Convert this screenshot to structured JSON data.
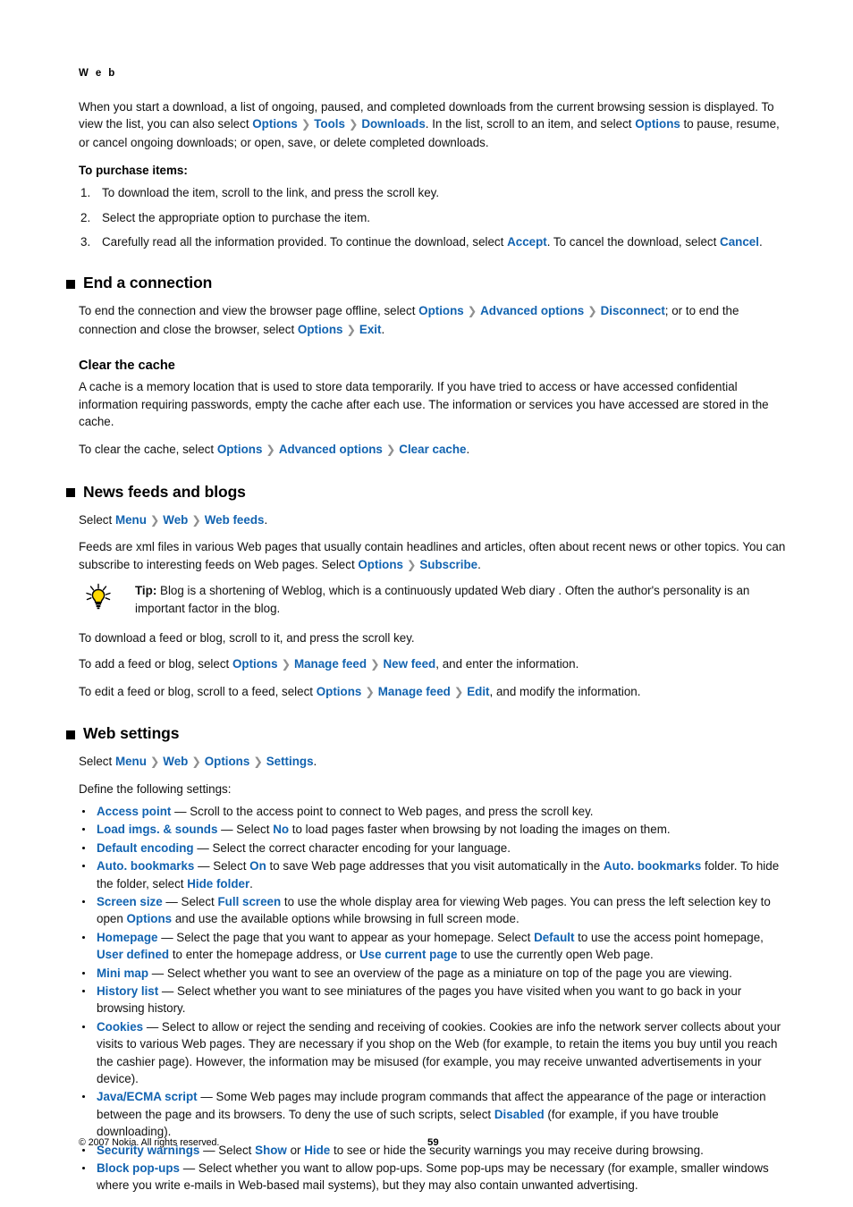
{
  "running_head": "W e b",
  "intro": {
    "l1_a": "When you start a download, a list of ongoing, paused, and completed downloads from the current browsing session is displayed. To view the list, you can also select ",
    "opt1": "Options",
    "tools": "Tools",
    "downloads": "Downloads",
    "l1_b": ". In the list, scroll to an item, and select ",
    "opt2": "Options",
    "l1_c": " to pause, resume, or cancel ongoing downloads; or open, save, or delete completed downloads."
  },
  "purchase": {
    "lead": "To purchase items:",
    "steps": [
      {
        "text_a": "To download the item, scroll to the link, and press the scroll key.",
        "link1": "",
        "text_b": "",
        "link2": "",
        "text_c": ""
      },
      {
        "text_a": "Select the appropriate option to purchase the item.",
        "link1": "",
        "text_b": "",
        "link2": "",
        "text_c": ""
      },
      {
        "text_a": "Carefully read all the information provided. To continue the download, select ",
        "link1": "Accept",
        "text_b": ". To cancel the download, select ",
        "link2": "Cancel",
        "text_c": "."
      }
    ]
  },
  "end_connection": {
    "title": "End a connection",
    "p1_a": "To end the connection and view the browser page offline, select ",
    "opt1": "Options",
    "adv": "Advanced options",
    "disconnect": "Disconnect",
    "p1_b": "; or to end the connection and close the browser, select ",
    "opt2": "Options",
    "exit": "Exit",
    "p1_c": "."
  },
  "clear_cache": {
    "title": "Clear the cache",
    "p1": "A cache is a memory location that is used to store data temporarily. If you have tried to access or have accessed confidential information requiring passwords, empty the cache after each use. The information or services you have accessed are stored in the cache.",
    "p2_a": "To clear the cache, select ",
    "opt": "Options",
    "adv": "Advanced options",
    "clear": "Clear cache",
    "p2_b": "."
  },
  "news_feeds": {
    "title": "News feeds and blogs",
    "select_a": "Select ",
    "menu": "Menu",
    "web": "Web",
    "webfeeds": "Web feeds",
    "select_b": ".",
    "p1_a": "Feeds are xml files in various Web pages that usually contain headlines and articles, often about recent news or other topics. You can subscribe to interesting feeds on Web pages. Select ",
    "options": "Options",
    "subscribe": "Subscribe",
    "p1_b": ".",
    "tip_label": "Tip:",
    "tip_text": " Blog is a shortening of Weblog, which is a continuously updated Web diary . Often the author's personality is an important factor in the blog.",
    "tip_icon": "lightbulb-icon",
    "p2": "To download a feed or blog, scroll to it, and press the scroll key.",
    "p3_a": "To add a feed or blog, select ",
    "p3_opt": "Options",
    "p3_manage": "Manage feed",
    "p3_new": "New feed",
    "p3_b": ", and enter the information.",
    "p4_a": "To edit a feed or blog, scroll to a feed, select ",
    "p4_opt": "Options",
    "p4_manage": "Manage feed",
    "p4_edit": "Edit",
    "p4_b": ", and modify the information."
  },
  "web_settings": {
    "title": "Web settings",
    "select_a": "Select ",
    "menu": "Menu",
    "web": "Web",
    "options": "Options",
    "settings": "Settings",
    "select_b": ".",
    "define": "Define the following settings:",
    "items": [
      {
        "parts": [
          {
            "t": "Access point",
            "link": true
          },
          {
            "t": " — Scroll to the access point to connect to Web pages, and press the scroll key.",
            "link": false
          }
        ]
      },
      {
        "parts": [
          {
            "t": "Load imgs. & sounds",
            "link": true
          },
          {
            "t": " — Select ",
            "link": false
          },
          {
            "t": "No",
            "link": true
          },
          {
            "t": " to load pages faster when browsing by not loading the images on them.",
            "link": false
          }
        ]
      },
      {
        "parts": [
          {
            "t": "Default encoding",
            "link": true
          },
          {
            "t": " — Select the correct character encoding for your language.",
            "link": false
          }
        ]
      },
      {
        "parts": [
          {
            "t": "Auto. bookmarks",
            "link": true
          },
          {
            "t": " — Select ",
            "link": false
          },
          {
            "t": "On",
            "link": true
          },
          {
            "t": " to save Web page addresses that you visit automatically in the ",
            "link": false
          },
          {
            "t": "Auto. bookmarks",
            "link": true
          },
          {
            "t": " folder. To hide the folder, select ",
            "link": false
          },
          {
            "t": "Hide folder",
            "link": true
          },
          {
            "t": ".",
            "link": false
          }
        ]
      },
      {
        "parts": [
          {
            "t": "Screen size",
            "link": true
          },
          {
            "t": " — Select ",
            "link": false
          },
          {
            "t": "Full screen",
            "link": true
          },
          {
            "t": " to use the whole display area for viewing Web pages. You can press the left selection key to open ",
            "link": false
          },
          {
            "t": "Options",
            "link": true
          },
          {
            "t": " and use the available options while browsing in full screen mode.",
            "link": false
          }
        ]
      },
      {
        "parts": [
          {
            "t": "Homepage",
            "link": true
          },
          {
            "t": " — Select the page that you want to appear as your homepage. Select ",
            "link": false
          },
          {
            "t": "Default",
            "link": true
          },
          {
            "t": " to use the access point homepage, ",
            "link": false
          },
          {
            "t": "User defined",
            "link": true
          },
          {
            "t": " to enter the homepage address, or ",
            "link": false
          },
          {
            "t": "Use current page",
            "link": true
          },
          {
            "t": " to use the currently open Web page.",
            "link": false
          }
        ]
      },
      {
        "parts": [
          {
            "t": "Mini map",
            "link": true
          },
          {
            "t": " — Select whether you want to see an overview of the page as a miniature on top of the page you are viewing.",
            "link": false
          }
        ]
      },
      {
        "parts": [
          {
            "t": "History list",
            "link": true
          },
          {
            "t": " — Select whether you want to see miniatures of the pages you have visited when you want to go back in your browsing history.",
            "link": false
          }
        ]
      },
      {
        "parts": [
          {
            "t": "Cookies",
            "link": true
          },
          {
            "t": " — Select to allow or reject the sending and receiving of cookies. Cookies are info the network server collects about your visits to various Web pages. They are necessary if you shop on the Web (for example, to retain the items you buy until you reach the cashier page). However, the information may be misused (for example, you may receive unwanted advertisements in your device).",
            "link": false
          }
        ]
      },
      {
        "parts": [
          {
            "t": "Java/ECMA script",
            "link": true
          },
          {
            "t": " — Some Web pages may include program commands that affect the appearance of the page or interaction between the page and its browsers. To deny the use of such scripts, select ",
            "link": false
          },
          {
            "t": "Disabled",
            "link": true
          },
          {
            "t": " (for example, if you have trouble downloading).",
            "link": false
          }
        ]
      },
      {
        "parts": [
          {
            "t": "Security warnings",
            "link": true
          },
          {
            "t": " — Select ",
            "link": false
          },
          {
            "t": "Show",
            "link": true
          },
          {
            "t": " or ",
            "link": false
          },
          {
            "t": "Hide",
            "link": true
          },
          {
            "t": " to see or hide the security warnings you may receive during browsing.",
            "link": false
          }
        ]
      },
      {
        "parts": [
          {
            "t": "Block pop-ups",
            "link": true
          },
          {
            "t": " — Select whether you want to allow pop-ups. Some pop-ups may be necessary (for example, smaller windows where you write e-mails in Web-based mail systems), but they may also contain unwanted advertising.",
            "link": false
          }
        ]
      }
    ]
  },
  "footer": {
    "copyright": "© 2007 Nokia. All rights reserved.",
    "page_number": "59"
  },
  "colors": {
    "link": "#1263b0",
    "separator": "#8f8f8f",
    "text": "#111111",
    "tip_bulb": "#ffd900"
  },
  "separator_glyph": "❯"
}
